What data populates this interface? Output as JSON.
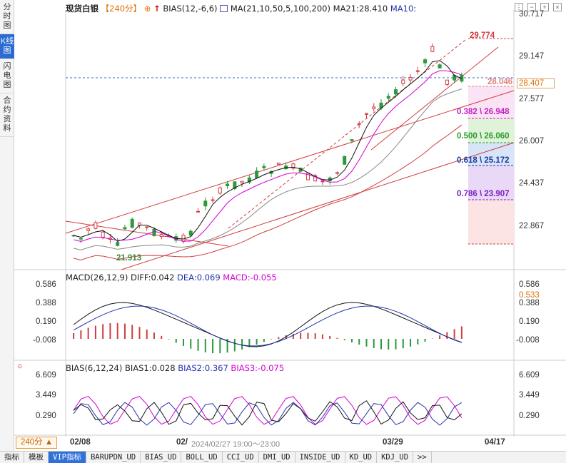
{
  "left_tabs": [
    {
      "label": "分时图",
      "active": false
    },
    {
      "label": "K线图",
      "active": true
    },
    {
      "label": "闪电图",
      "active": false
    },
    {
      "label": "合约资料",
      "active": false
    }
  ],
  "header": {
    "symbol": "现货白银",
    "period_tag": "【240分】",
    "bias_label": "BIAS(12,-6,6)",
    "ma_label": "MA(21,10,50,5,100,200)",
    "ma21": "MA21:28.410",
    "ma10": "MA10:"
  },
  "main_axis": [
    "30.717",
    "29.147",
    "27.577",
    "26.007",
    "24.437",
    "22.867"
  ],
  "price_current": "28.407",
  "annotations": {
    "high": "29.774",
    "low": "21.913",
    "fib_382": "0.382 \\ 26.948",
    "fib_500": "0.500 \\ 26.060",
    "fib_618": "0.618 \\ 25.172",
    "fib_786": "0.786 \\ 23.907",
    "fib_top": "28.046"
  },
  "macd": {
    "label": "MACD(26,12,9)",
    "diff": "DIFF:0.042",
    "dea": "DEA:0.069",
    "macd": "MACD:-0.055",
    "axis": [
      "0.586",
      "0.388",
      "0.190",
      "-0.008"
    ],
    "current": "0.533"
  },
  "bias": {
    "label": "BIAS(6,12,24)",
    "b1": "BIAS1:0.028",
    "b2": "BIAS2:0.367",
    "b3": "BIAS3:-0.075",
    "axis": [
      "6.609",
      "3.449",
      "0.290"
    ]
  },
  "dates": [
    "02/08",
    "02/",
    "03/29",
    "04/17"
  ],
  "tooltip": "2024/02/27 19:00～23:00",
  "period_selector": "240分 ▲",
  "bottom_tabs": [
    {
      "label": "指标",
      "active": false
    },
    {
      "label": "模板",
      "active": false
    },
    {
      "label": "VIP指标",
      "active": true
    },
    {
      "label": "BARUPDN_UD",
      "active": false
    },
    {
      "label": "BIAS_UD",
      "active": false
    },
    {
      "label": "BOLL_UD",
      "active": false
    },
    {
      "label": "CCI_UD",
      "active": false
    },
    {
      "label": "DMI_UD",
      "active": false
    },
    {
      "label": "INSIDE_UD",
      "active": false
    },
    {
      "label": "KD_UD",
      "active": false
    },
    {
      "label": "KDJ_UD",
      "active": false
    },
    {
      "label": ">>",
      "active": false
    }
  ],
  "colors": {
    "up": "#d23c3c",
    "down": "#2a9a3a",
    "ma21": "#d400d4",
    "accent": "#2c6bd1"
  }
}
